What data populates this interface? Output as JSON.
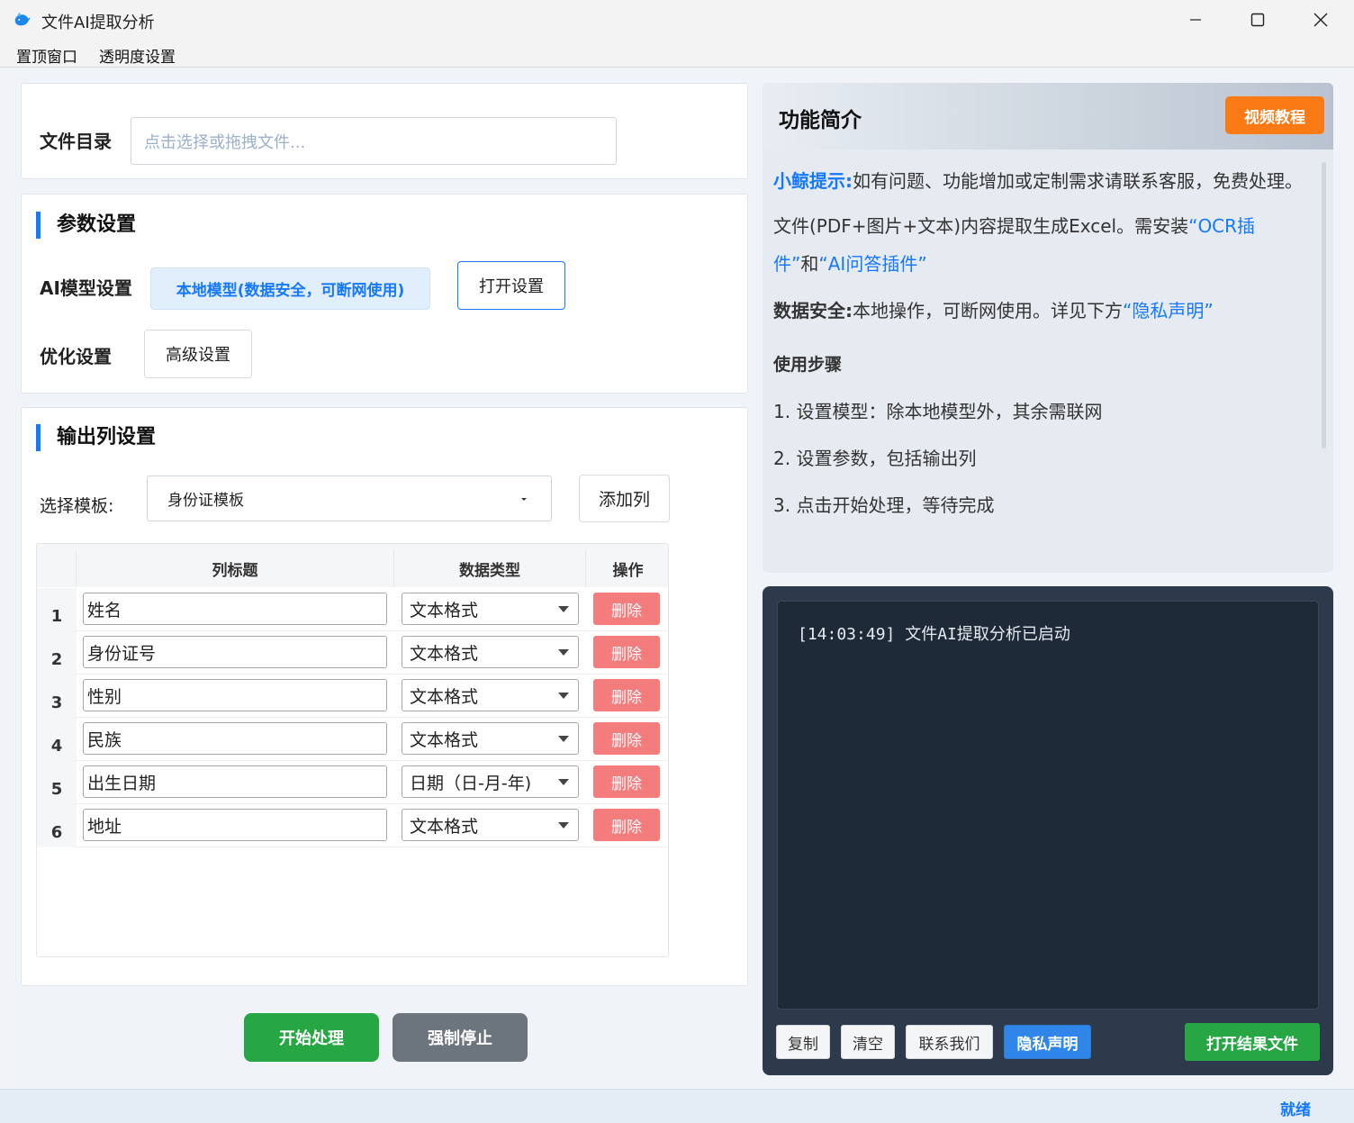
{
  "window": {
    "title": "文件AI提取分析"
  },
  "menu": {
    "items": [
      "置顶窗口",
      "透明度设置"
    ]
  },
  "file": {
    "label": "文件目录",
    "placeholder": "点击选择或拖拽文件..."
  },
  "params": {
    "title": "参数设置",
    "model_label": "AI模型设置",
    "model_value": "本地模型(数据安全，可断网使用)",
    "open_settings": "打开设置",
    "optimize_label": "优化设置",
    "advanced": "高级设置"
  },
  "output": {
    "title": "输出列设置",
    "template_label": "选择模板:",
    "template_value": "身份证模板",
    "add_column": "添加列",
    "headers": [
      "列标题",
      "数据类型",
      "操作"
    ],
    "rows": [
      {
        "num": "1",
        "title": "姓名",
        "type": "文本格式",
        "action": "删除"
      },
      {
        "num": "2",
        "title": "身份证号",
        "type": "文本格式",
        "action": "删除"
      },
      {
        "num": "3",
        "title": "性别",
        "type": "文本格式",
        "action": "删除"
      },
      {
        "num": "4",
        "title": "民族",
        "type": "文本格式",
        "action": "删除"
      },
      {
        "num": "5",
        "title": "出生日期",
        "type": "日期（日-月-年)",
        "action": "删除"
      },
      {
        "num": "6",
        "title": "地址",
        "type": "文本格式",
        "action": "删除"
      }
    ]
  },
  "actions": {
    "start": "开始处理",
    "stop": "强制停止"
  },
  "intro": {
    "title": "功能简介",
    "video_button": "视频教程",
    "tip_label": "小鲸提示:",
    "tip_text": "如有问题、功能增加或定制需求请联系客服，免费处理。",
    "desc_pre": "文件(PDF+图片+文本)内容提取生成Excel。需安装",
    "ocr_plugin": "“OCR插件”",
    "desc_and": "和",
    "ai_plugin": "“AI问答插件”",
    "security_label": "数据安全:",
    "security_text": "本地操作，可断网使用。详见下方",
    "privacy_link": "“隐私声明”",
    "steps_title": "使用步骤",
    "steps": [
      "1. 设置模型：除本地模型外，其余需联网",
      "2. 设置参数，包括输出列",
      "3. 点击开始处理，等待完成"
    ]
  },
  "console": {
    "log": "[14:03:49] 文件AI提取分析已启动",
    "copy": "复制",
    "clear": "清空",
    "contact": "联系我们",
    "privacy": "隐私声明",
    "open_result": "打开结果文件"
  },
  "status": {
    "text": "就绪"
  },
  "colors": {
    "accent": "#1677ff",
    "orange": "#fa7a15",
    "green": "#27a744",
    "danger": "#f47c7c",
    "grey": "#6c757d"
  }
}
